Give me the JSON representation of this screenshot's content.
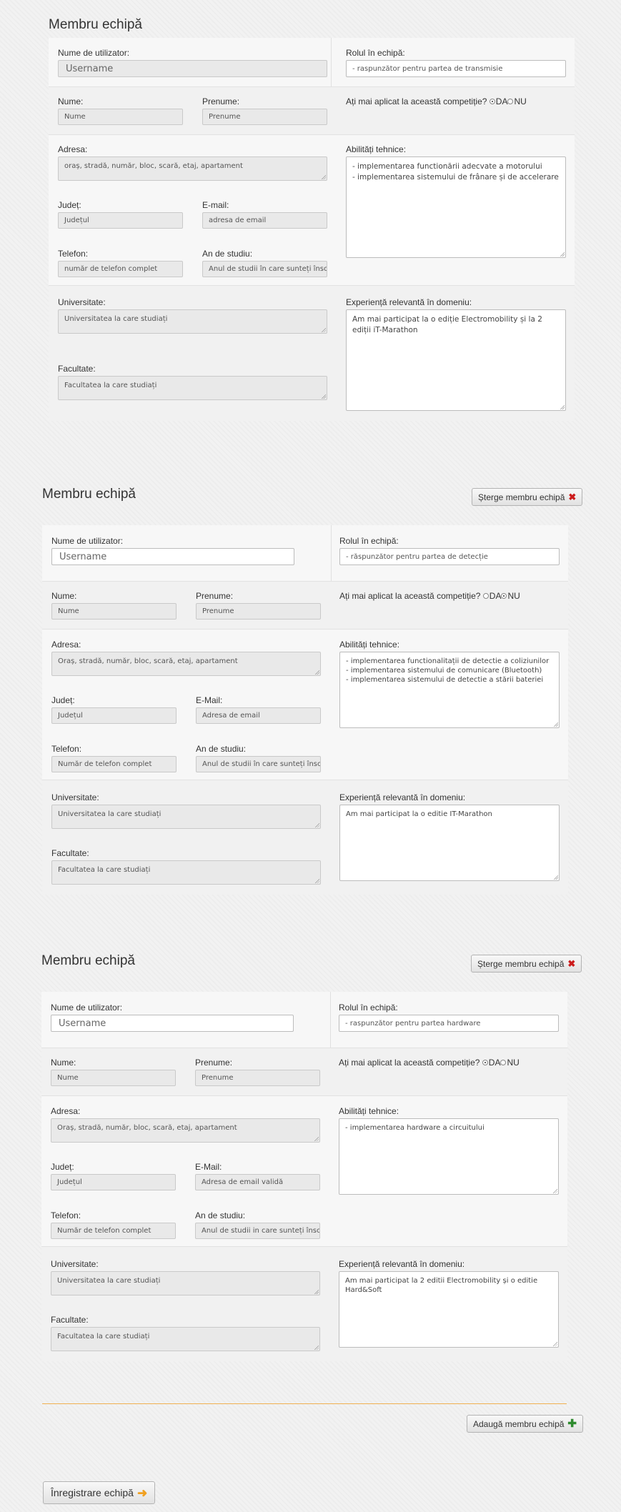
{
  "labels": {
    "member_title": "Membru echipă",
    "username": "Nume de utilizator:",
    "role": "Rolul în echipă:",
    "lastname": "Nume:",
    "firstname": "Prenume:",
    "applied": "Ați mai aplicat la această competiție?",
    "yes": "DA",
    "no": "NU",
    "address": "Adresa:",
    "skills": "Abilități tehnice:",
    "county": "Județ:",
    "email_a": "E-mail:",
    "email_b": "E-Mail:",
    "phone": "Telefon:",
    "study_year": "An de studiu:",
    "university": "Universitate:",
    "experience": "Experiență relevantă în domeniu:",
    "faculty": "Facultate:"
  },
  "buttons": {
    "delete_member": "Șterge membru echipă",
    "add_member": "Adaugă membru echipă",
    "register_team": "Înregistrare echipă"
  },
  "icons": {
    "delete": "x-icon",
    "add": "plus-icon",
    "submit": "arrow-right-icon"
  },
  "colors": {
    "delete_icon": "#cc1b1b",
    "add_icon": "#2e8b2e",
    "arrow_icon": "#f0a020",
    "divider": "#f0b050"
  },
  "members": [
    {
      "username_placeholder": "Username",
      "role": " - raspunzător pentru partea de transmisie",
      "lastname_placeholder": "Nume",
      "firstname_placeholder": "Prenume",
      "applied": "yes",
      "address_placeholder": "oraș, stradă, număr, bloc, scară, etaj, apartament",
      "county_placeholder": "Județul",
      "email_placeholder": "adresa de email",
      "phone_placeholder": "număr de telefon complet",
      "study_placeholder": "Anul de studii în care sunteți înscris",
      "university_placeholder": "Universitatea la care studiați",
      "faculty_placeholder": "Facultatea la care studiați",
      "skills_lines": [
        "- implementarea functionării adecvate a motorului",
        "- implementarea sistemului de frânare și de accelerare"
      ],
      "experience": "Am mai participat la o ediție Electromobility și la 2 ediții iT-Marathon"
    },
    {
      "username_placeholder": "Username",
      "role": "- răspunzător pentru partea de detecție",
      "lastname_placeholder": "Nume",
      "firstname_placeholder": "Prenume",
      "applied": "no",
      "address_placeholder": "Oraș, stradă, număr, bloc, scară, etaj, apartament",
      "county_placeholder": "Județul",
      "email_placeholder": "Adresa de email",
      "phone_placeholder": "Număr de telefon complet",
      "study_placeholder": "Anul de studii în care sunteți înscris",
      "university_placeholder": "Universitatea la care studiați",
      "faculty_placeholder": "Facultatea la care studiați",
      "skills_lines": [
        "- implementarea functionalitații de detectie a coliziunilor",
        "- implementarea sistemului de comunicare (Bluetooth)",
        "- implementarea sistemului de detectie a stării bateriei"
      ],
      "experience": "Am mai participat la o editie IT-Marathon"
    },
    {
      "username_placeholder": "Username",
      "role": "- raspunzător pentru partea hardware",
      "lastname_placeholder": "Nume",
      "firstname_placeholder": "Prenume",
      "applied": "yes",
      "address_placeholder": "Oraș, stradă, număr, bloc, scară, etaj, apartament",
      "county_placeholder": "Județul",
      "email_placeholder": "Adresa de email validă",
      "phone_placeholder": "Număr de telefon complet",
      "study_placeholder": "Anul de studii in care sunteți înscris",
      "university_placeholder": "Universitatea la care studiați",
      "faculty_placeholder": "Facultatea la care studiați",
      "skills_lines": [
        "- implementarea hardware a circuitului"
      ],
      "experience": "Am mai participat la 2 editii Electromobility și o editie Hard&Soft"
    }
  ]
}
